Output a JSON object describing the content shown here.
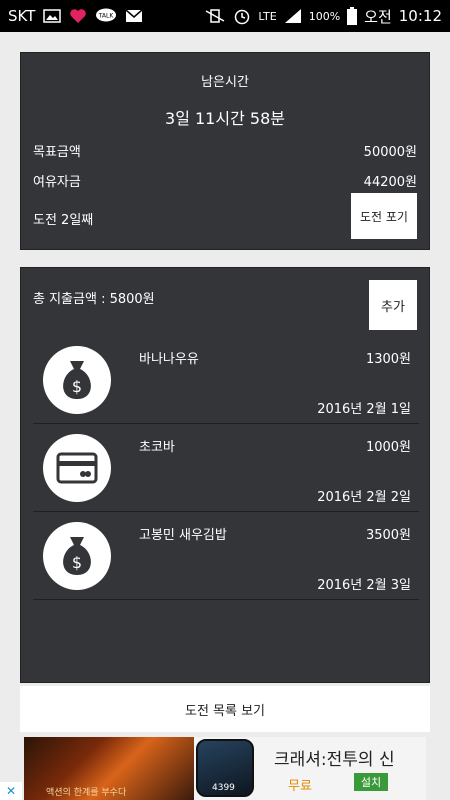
{
  "statusbar": {
    "carrier": "SKT",
    "network": "LTE",
    "battery": "100%",
    "ampm": "오전",
    "time": "10:12"
  },
  "challenge": {
    "remaining_label": "남은시간",
    "remaining_value": "3일 11시간 58분",
    "target_label": "목표금액",
    "target_value": "50000원",
    "spare_label": "여유자금",
    "spare_value": "44200원",
    "day_label": "도전 2일째",
    "giveup_label": "도전 포기"
  },
  "spending": {
    "total_label": "총 지출금액 : 5800원",
    "add_label": "추가",
    "items": [
      {
        "name": "바나나우유",
        "amount": "1300원",
        "date": "2016년 2월 1일",
        "icon": "money-bag-icon"
      },
      {
        "name": "초코바",
        "amount": "1000원",
        "date": "2016년 2월 2일",
        "icon": "credit-card-icon"
      },
      {
        "name": "고봉민 새우김밥",
        "amount": "3500원",
        "date": "2016년 2월 3일",
        "icon": "money-bag-icon"
      }
    ]
  },
  "bottom": {
    "list_label": "도전 목록 보기"
  },
  "ad": {
    "caption": "액션의 한계를 부수다",
    "app_badge": "4399",
    "title": "크래셔:전투의 신",
    "price": "무료",
    "install_label": "설치",
    "close_label": "✕"
  },
  "colors": {
    "card_bg": "#333539",
    "page_bg": "#ececec",
    "ad_price": "#e08a00",
    "ad_install": "#3a9a3a"
  }
}
